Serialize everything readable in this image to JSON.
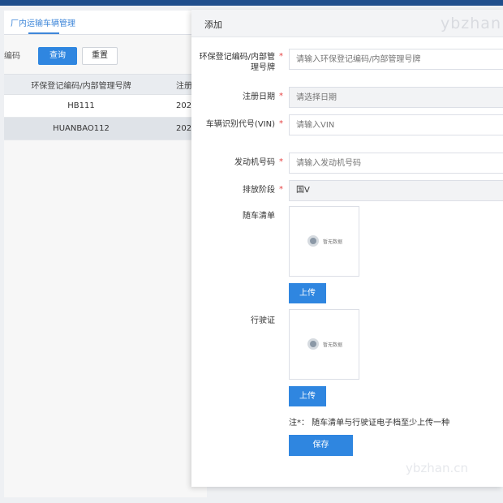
{
  "background_page": {
    "tab_label": "厂内运输车辆管理",
    "filter_label": "编码",
    "query_button": "查询",
    "reset_button": "重置",
    "table": {
      "columns": [
        "环保登记编码/内部管理号牌",
        "注册"
      ],
      "rows": [
        {
          "code": "HB111",
          "date": "202"
        },
        {
          "code": "HUANBAO112",
          "date": "202"
        }
      ]
    }
  },
  "dialog": {
    "title": "添加",
    "watermark": "ybzhan",
    "fields": {
      "env_code": {
        "label": "环保登记编码/内部管理号牌",
        "required_mark": "*",
        "placeholder": "请输入环保登记编码/内部管理号牌"
      },
      "reg_date": {
        "label": "注册日期",
        "required_mark": "*",
        "placeholder": "请选择日期"
      },
      "vin": {
        "label": "车辆识别代号(VIN)",
        "required_mark": "*",
        "placeholder": "请输入VIN"
      },
      "engine_no": {
        "label": "发动机号码",
        "required_mark": "*",
        "placeholder": "请输入发动机号码"
      },
      "emission_stage": {
        "label": "排放阶段",
        "required_mark": "*",
        "value": "国V"
      }
    },
    "vehicle_list": {
      "label": "随车清单",
      "placeholder_text": "暂无数据",
      "upload_button": "上传"
    },
    "driving_license": {
      "label": "行驶证",
      "placeholder_text": "暂无数据",
      "upload_button": "上传"
    },
    "note": "注*： 随车清单与行驶证电子档至少上传一种",
    "save_button": "保存",
    "bottom_watermark": "ybzhan.cn"
  }
}
